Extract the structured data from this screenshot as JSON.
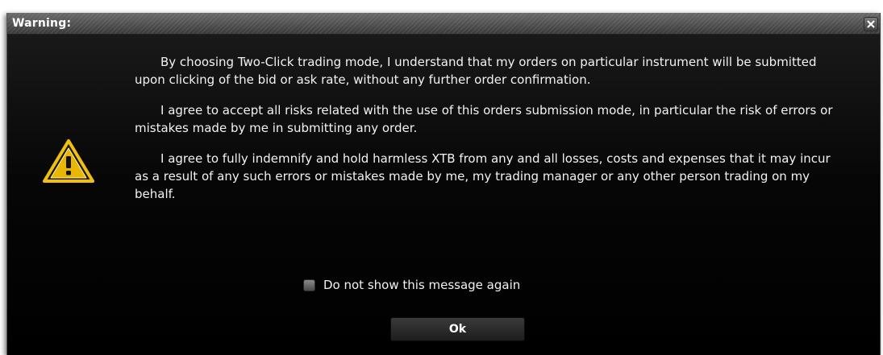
{
  "dialog": {
    "title": "Warning:",
    "close_icon": "close-icon",
    "warning_icon": "warning-triangle-icon",
    "paragraphs": [
      "By choosing Two-Click trading mode, I understand that my orders on particular instrument will be submitted upon clicking of the bid or ask rate, without any further order confirmation.",
      "I agree to accept all risks related with the use of this orders submission mode, in particular the risk of errors or mistakes made by me in submitting any order.",
      "I agree to fully indemnify and hold harmless XTB from any and all losses, costs and expenses that it may incur as a result of any such errors or mistakes made by me, my trading manager or any other person trading on my behalf."
    ],
    "checkbox_label": "Do not show this message again",
    "checkbox_checked": false,
    "ok_label": "Ok"
  },
  "colors": {
    "background": "#000000",
    "text": "#f2f2f2",
    "icon_yellow": "#f2c200"
  }
}
